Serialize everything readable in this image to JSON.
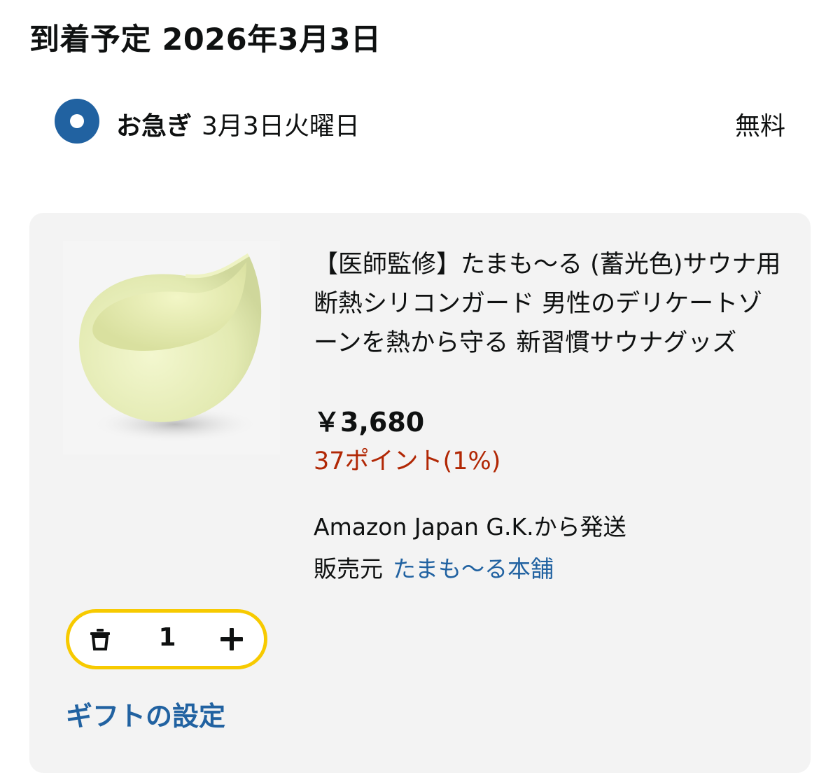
{
  "delivery": {
    "heading": "到着予定 2026年3月3日",
    "option": {
      "name": "お急ぎ",
      "date": "3月3日火曜日",
      "price": "無料",
      "selected": true
    }
  },
  "item": {
    "title": "【医師監修】たまも～る (蓄光色)サウナ用 断熱シリコンガード 男性のデリケートゾーンを熱から守る 新習慣サウナグッズ",
    "price": "￥3,680",
    "points": "37ポイント(1%)",
    "ships_from": "Amazon Japan G.K.から発送",
    "seller_prefix": "販売元",
    "seller_name": "たまも～る本舗",
    "quantity": "1",
    "gift_label": "ギフトの設定"
  },
  "icons": {
    "radio": "radio-selected-icon",
    "trash": "trash-icon",
    "plus": "plus-icon"
  },
  "colors": {
    "link": "#2162a1",
    "points": "#b12704",
    "stepper_border": "#f7ca00",
    "card_bg": "#f3f3f3"
  }
}
